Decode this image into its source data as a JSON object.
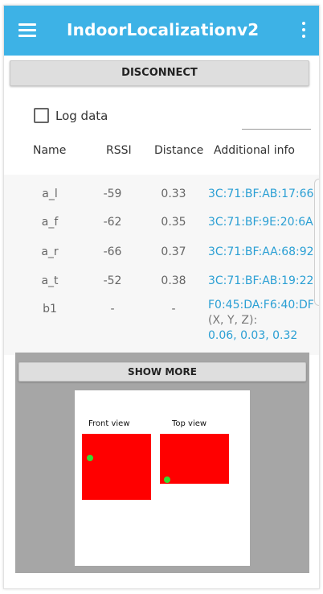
{
  "app": {
    "title": "IndoorLocalizationv2",
    "menu_icon": "hamburger-menu-icon",
    "overflow_icon": "more-vert-icon",
    "accent_color": "#3db2e6"
  },
  "actions": {
    "disconnect_label": "DISCONNECT",
    "log_data_label": "Log data",
    "log_data_checked": false,
    "show_more_label": "SHOW MORE"
  },
  "table": {
    "headers": {
      "name": "Name",
      "rssi": "RSSI",
      "distance": "Distance",
      "info": "Additional info"
    },
    "rows": [
      {
        "name": "a_l",
        "rssi": "-59",
        "distance": "0.33",
        "info": "3C:71:BF:AB:17:66"
      },
      {
        "name": "a_f",
        "rssi": "-62",
        "distance": "0.35",
        "info": "3C:71:BF:9E:20:6A"
      },
      {
        "name": "a_r",
        "rssi": "-66",
        "distance": "0.37",
        "info": "3C:71:BF:AA:68:92"
      },
      {
        "name": "a_t",
        "rssi": "-52",
        "distance": "0.38",
        "info": "3C:71:BF:AB:19:22"
      },
      {
        "name": "b1",
        "rssi": "-",
        "distance": "-",
        "info": "F0:45:DA:F6:40:DF",
        "coords_label": "(X, Y, Z):",
        "coords": "0.06, 0.03, 0.32"
      }
    ]
  },
  "visualization": {
    "front_view_label": "Front view",
    "top_view_label": "Top view",
    "box_color": "#ff0000",
    "marker_color": "#33dd33"
  }
}
